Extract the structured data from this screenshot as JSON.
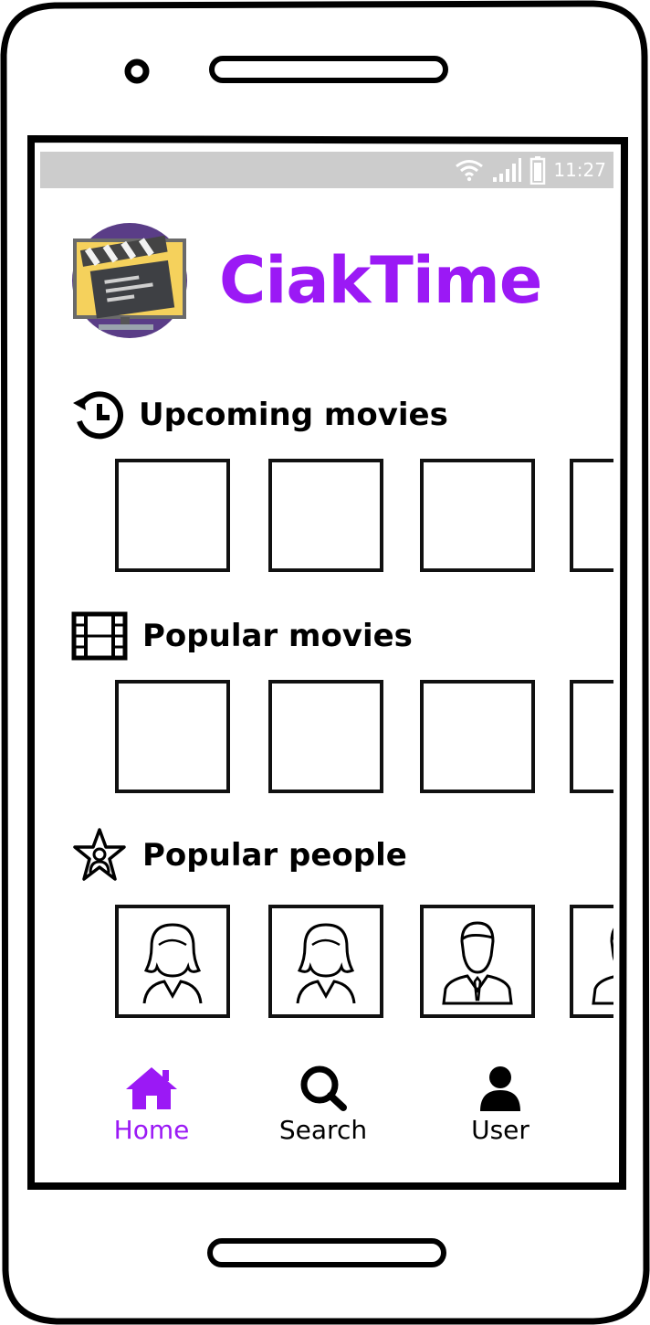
{
  "status_bar": {
    "time": "11:27"
  },
  "app": {
    "title": "CiakTime",
    "accent_color": "#9b19f5"
  },
  "sections": [
    {
      "title": "Upcoming movies",
      "icon": "history-icon",
      "tiles": [
        "placeholder",
        "placeholder",
        "placeholder",
        "placeholder"
      ]
    },
    {
      "title": "Popular movies",
      "icon": "film-strip-icon",
      "tiles": [
        "placeholder",
        "placeholder",
        "placeholder",
        "placeholder"
      ]
    },
    {
      "title": "Popular people",
      "icon": "star-person-icon",
      "tiles": [
        "woman-avatar",
        "woman-avatar",
        "man-avatar",
        "man-avatar"
      ]
    }
  ],
  "bottom_nav": [
    {
      "label": "Home",
      "icon": "home-icon",
      "active": true
    },
    {
      "label": "Search",
      "icon": "search-icon",
      "active": false
    },
    {
      "label": "User",
      "icon": "user-icon",
      "active": false
    }
  ]
}
